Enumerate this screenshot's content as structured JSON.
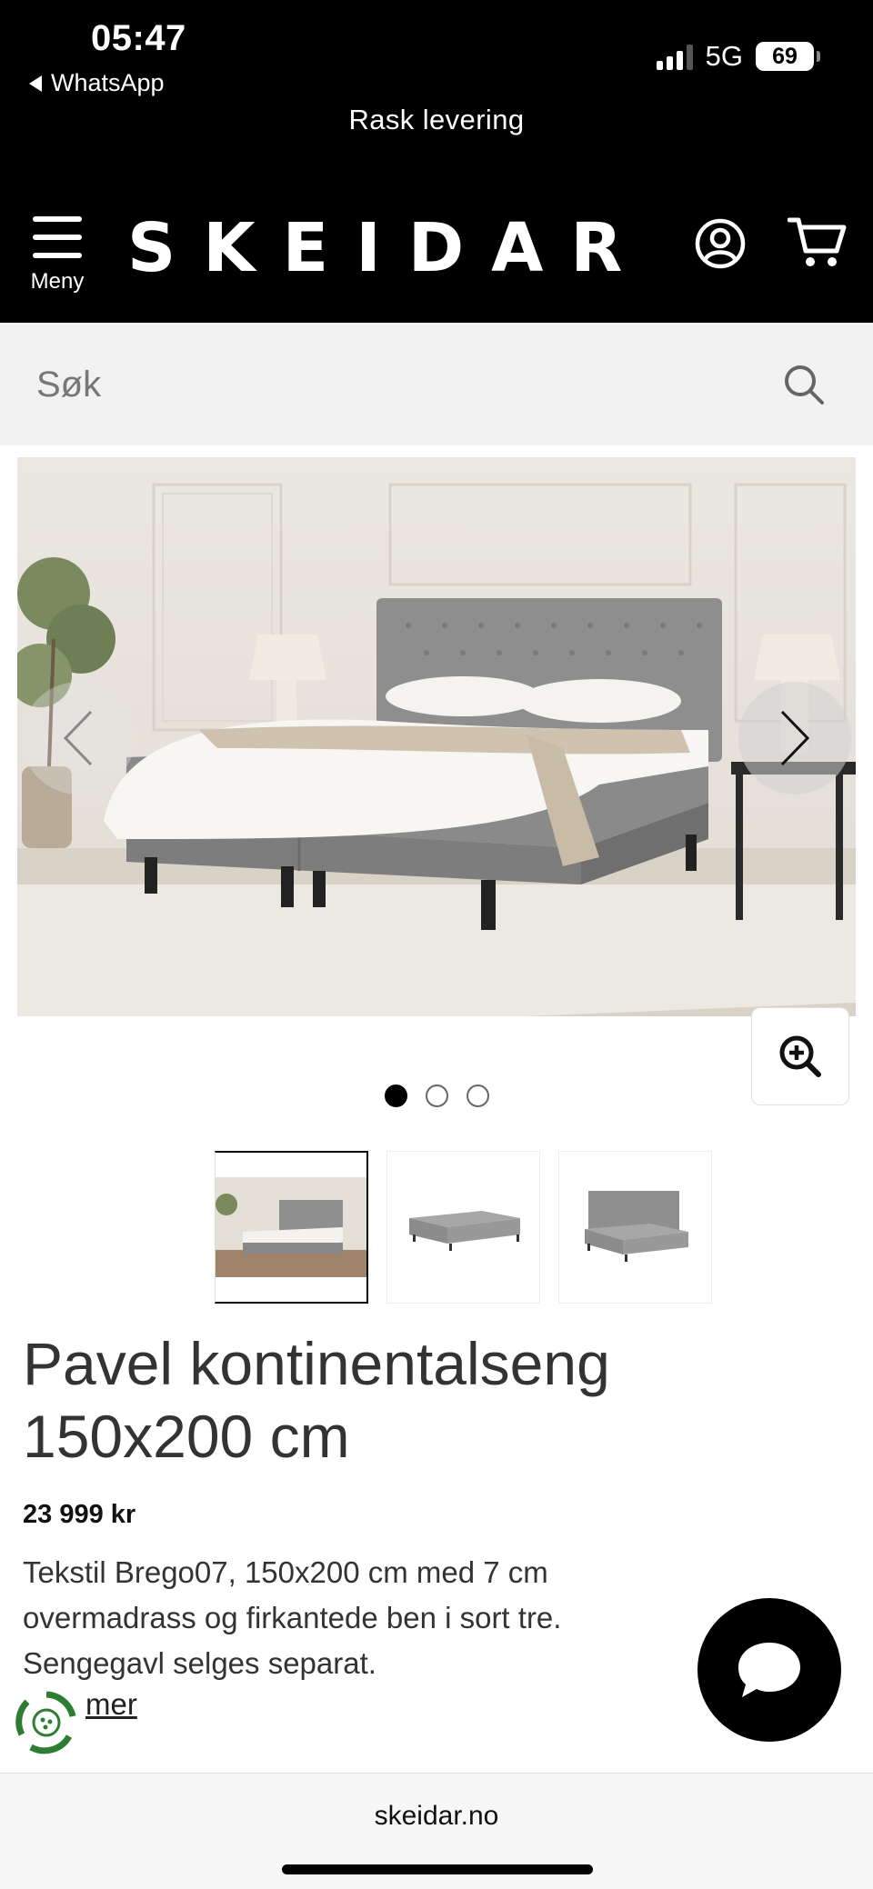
{
  "status_bar": {
    "time": "05:47",
    "back_app": "WhatsApp",
    "network": "5G",
    "battery": "69"
  },
  "header": {
    "promo": "Rask levering",
    "menu_label": "Meny",
    "logo": "SKEIDAR"
  },
  "search": {
    "placeholder": "Søk"
  },
  "gallery": {
    "dots": 3,
    "active_index": 0,
    "thumbnails": 3
  },
  "product": {
    "title": "Pavel kontinentalseng 150x200 cm",
    "price": "23 999 kr",
    "description": "Tekstil Brego07, 150x200 cm med 7 cm overmadrass og firkantede ben i sort tre. Sengegavl selges separat.",
    "more_link": "mer"
  },
  "browser": {
    "url": "skeidar.no"
  },
  "colors": {
    "header_bg": "#000000",
    "search_bg": "#f2f2f2",
    "text": "#333333",
    "eco_green": "#2e7d32"
  }
}
